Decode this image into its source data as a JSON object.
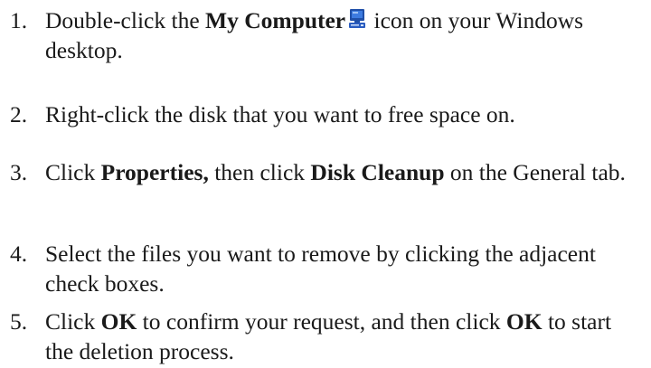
{
  "steps": [
    {
      "number": "1.",
      "pre": "Double-click the ",
      "bold": "My Computer",
      "icon": "my-computer-icon",
      "post": " icon on your Windows desktop."
    },
    {
      "number": "2.",
      "text": "Right-click the disk that you want to free space on."
    },
    {
      "number": "3.",
      "pre": "Click ",
      "bold1": "Properties,",
      "mid": " then click ",
      "bold2": "Disk Cleanup",
      "post": " on the General tab."
    },
    {
      "number": "4.",
      "text": "Select the files you want to remove by clicking the adjacent check boxes."
    },
    {
      "number": "5.",
      "pre": "Click ",
      "bold1": "OK",
      "mid": " to confirm your request, and then click ",
      "bold2": "OK",
      "post": " to start the deletion process."
    }
  ],
  "colors": {
    "text": "#1a1a1a",
    "icon_blue": "#1f4fa8",
    "icon_screen": "#3d7be0"
  }
}
